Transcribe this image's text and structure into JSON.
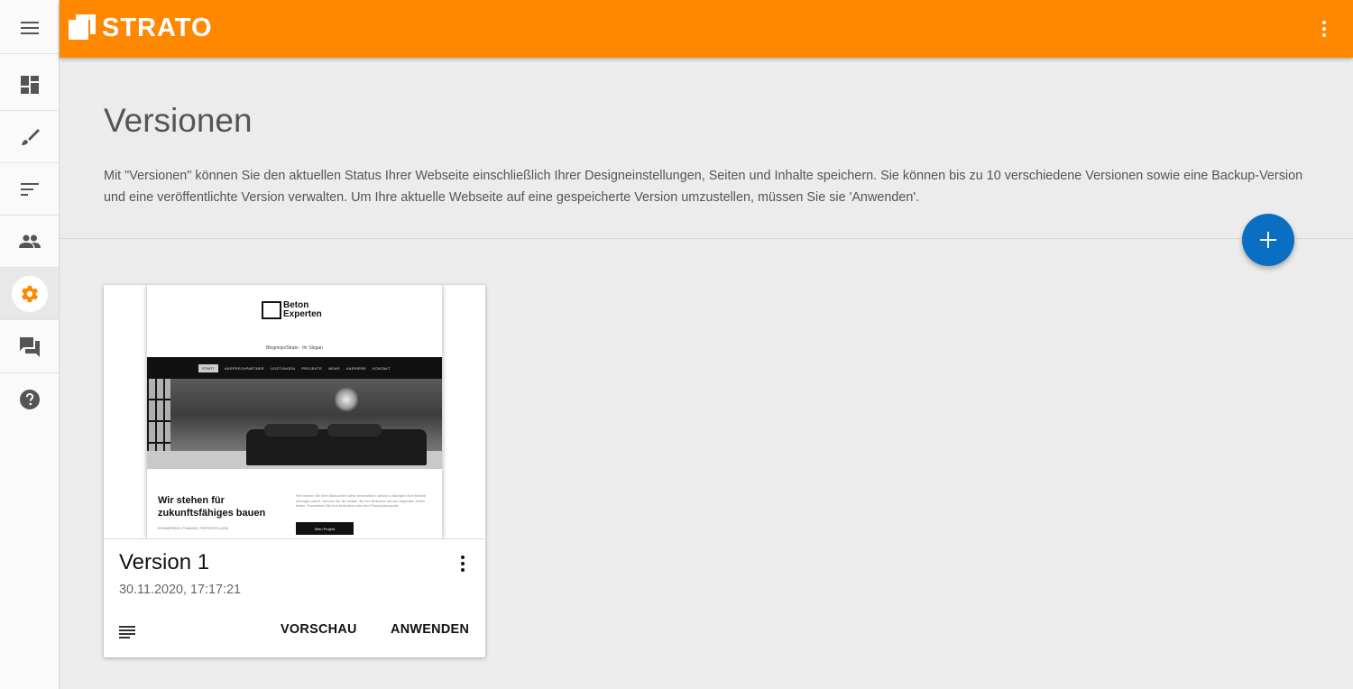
{
  "app": {
    "brand": "STRATO",
    "accent_color": "#ff8800",
    "fab_color": "#0a6fc2"
  },
  "sidebar": {
    "items": [
      {
        "icon": "menu-icon"
      },
      {
        "icon": "dashboard-icon"
      },
      {
        "icon": "brush-icon"
      },
      {
        "icon": "sort-icon"
      },
      {
        "icon": "people-icon"
      },
      {
        "icon": "gear-icon",
        "active": true
      },
      {
        "icon": "chat-icon"
      },
      {
        "icon": "help-icon"
      }
    ]
  },
  "main": {
    "title": "Versionen",
    "description": "Mit \"Versionen\" können Sie den aktuellen Status Ihrer Webseite einschließlich Ihrer Designeinstellungen, Seiten und Inhalte speichern. Sie können bis zu 10 verschiedene Versionen sowie eine Backup-Version und eine veröffentlichte Version verwalten. Um Ihre aktuelle Webseite auf eine gespeicherte Version umzustellen, müssen Sie sie 'Anwenden'.",
    "add_button_icon": "plus-icon"
  },
  "versions": [
    {
      "name": "Version 1",
      "date": "30.11.2020, 17:17:21",
      "preview_label": "VORSCHAU",
      "apply_label": "ANWENDEN",
      "thumbnail": {
        "logo_line1": "Beton",
        "logo_line2": "Experten",
        "slogan": "Blogmojo/Strato · Ihr Slogan",
        "nav": [
          "START",
          "ANSPRECHPARTNER",
          "LEISTUNGEN",
          "PROJEKTE",
          "NEWS",
          "KARRIERE",
          "KONTAKT"
        ],
        "headline": "Wir stehen für zukunftsfähiges bauen",
        "subline": "ENGINEERING | PLANUNG | FERTIGSTELLUNG",
        "body": "Hier können Sie Ihren Besuchern näher beschreiben, welche Leistungen Ihrer Betrieb erbringen macht. Nennen Sie die Inhalte, die Ihre Besucher auf den folgenden Seiten finden. Formulieren Sie Ihre Motivation oder Ihre Firmenphilosophie.",
        "button": "Mein Projekt"
      }
    }
  ]
}
